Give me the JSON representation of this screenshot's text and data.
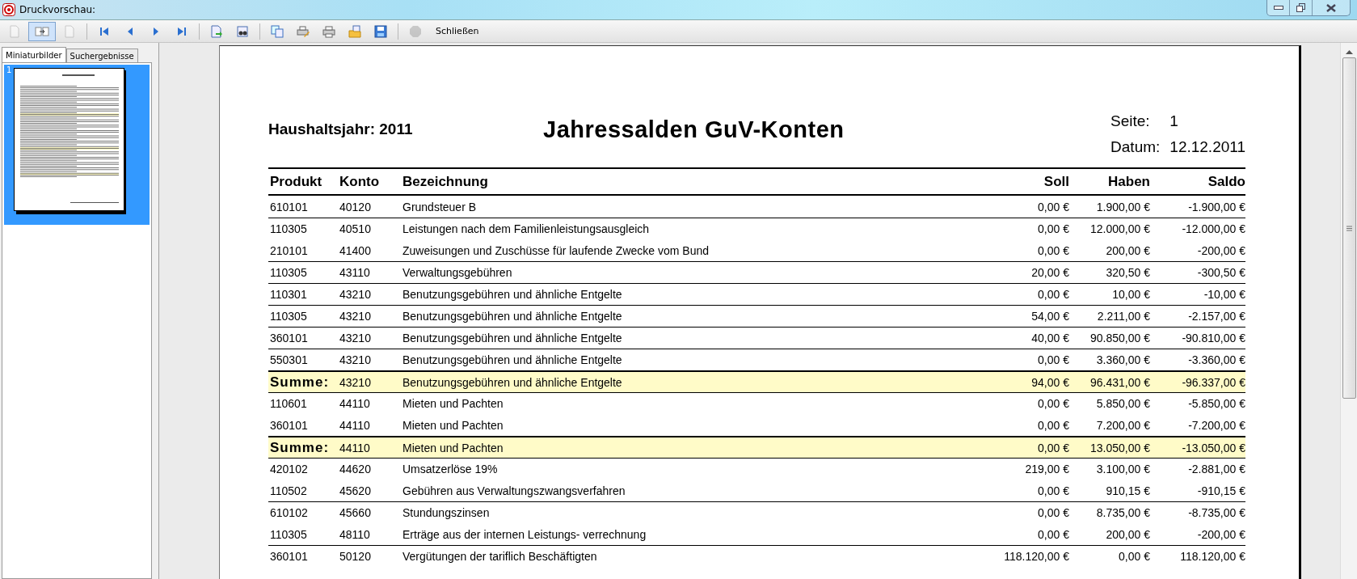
{
  "window": {
    "title": "Druckvorschau:"
  },
  "toolbar": {
    "buttons": [
      {
        "disabled": true,
        "selected": false
      },
      {
        "disabled": false,
        "selected": true
      },
      {
        "disabled": true,
        "selected": false
      },
      {
        "disabled": false,
        "selected": false
      },
      {
        "disabled": false,
        "selected": false
      },
      {
        "disabled": false,
        "selected": false
      },
      {
        "disabled": false,
        "selected": false
      },
      {
        "disabled": false,
        "selected": false
      },
      {
        "disabled": false,
        "selected": false
      },
      {
        "disabled": false,
        "selected": false
      },
      {
        "disabled": false,
        "selected": false
      },
      {
        "disabled": false,
        "selected": false
      },
      {
        "disabled": false,
        "selected": false
      },
      {
        "disabled": false,
        "selected": false
      },
      {
        "disabled": true,
        "selected": false
      }
    ],
    "close_label": "Schließen"
  },
  "sidebar": {
    "tabs": [
      {
        "label": "Miniaturbilder",
        "selected": true
      },
      {
        "label": "Suchergebnisse",
        "selected": false
      }
    ],
    "thumbnails": [
      {
        "number": "1",
        "selected": true
      }
    ]
  },
  "report": {
    "year_label": "Haushaltsjahr: 2011",
    "title": "Jahressalden GuV-Konten",
    "page_label": "Seite:",
    "page_value": "1",
    "date_label": "Datum:",
    "date_value": "12.12.2011",
    "columns": [
      "Produkt",
      "Konto",
      "Bezeichnung",
      "Soll",
      "Haben",
      "Saldo"
    ],
    "rows": [
      {
        "kind": "item",
        "rule_above": false,
        "cells": [
          "610101",
          "40120",
          "Grundsteuer B",
          "0,00 €",
          "1.900,00 €",
          "-1.900,00 €"
        ]
      },
      {
        "kind": "item",
        "rule_above": true,
        "cells": [
          "110305",
          "40510",
          "Leistungen nach dem Familienleistungsausgleich",
          "0,00 €",
          "12.000,00 €",
          "-12.000,00 €"
        ]
      },
      {
        "kind": "item",
        "rule_above": false,
        "cells": [
          "210101",
          "41400",
          "Zuweisungen und Zuschüsse für laufende Zwecke vom Bund",
          "0,00 €",
          "200,00 €",
          "-200,00 €"
        ]
      },
      {
        "kind": "item",
        "rule_above": true,
        "cells": [
          "110305",
          "43110",
          "Verwaltungsgebühren",
          "20,00 €",
          "320,50 €",
          "-300,50 €"
        ]
      },
      {
        "kind": "item",
        "rule_above": true,
        "cells": [
          "110301",
          "43210",
          "Benutzungsgebühren und ähnliche Entgelte",
          "0,00 €",
          "10,00 €",
          "-10,00 €"
        ]
      },
      {
        "kind": "item",
        "rule_above": true,
        "cells": [
          "110305",
          "43210",
          "Benutzungsgebühren und ähnliche Entgelte",
          "54,00 €",
          "2.211,00 €",
          "-2.157,00 €"
        ]
      },
      {
        "kind": "item",
        "rule_above": true,
        "cells": [
          "360101",
          "43210",
          "Benutzungsgebühren und ähnliche Entgelte",
          "40,00 €",
          "90.850,00 €",
          "-90.810,00 €"
        ]
      },
      {
        "kind": "item",
        "rule_above": true,
        "cells": [
          "550301",
          "43210",
          "Benutzungsgebühren und ähnliche Entgelte",
          "0,00 €",
          "3.360,00 €",
          "-3.360,00 €"
        ]
      },
      {
        "kind": "sum",
        "rule_above": true,
        "cells": [
          "Summe:",
          "43210",
          "Benutzungsgebühren und ähnliche Entgelte",
          "94,00 €",
          "96.431,00 €",
          "-96.337,00 €"
        ]
      },
      {
        "kind": "item",
        "rule_above": true,
        "cells": [
          "110601",
          "44110",
          "Mieten und Pachten",
          "0,00 €",
          "5.850,00 €",
          "-5.850,00 €"
        ]
      },
      {
        "kind": "item",
        "rule_above": false,
        "cells": [
          "360101",
          "44110",
          "Mieten und Pachten",
          "0,00 €",
          "7.200,00 €",
          "-7.200,00 €"
        ]
      },
      {
        "kind": "sum",
        "rule_above": true,
        "cells": [
          "Summe:",
          "44110",
          "Mieten und Pachten",
          "0,00 €",
          "13.050,00 €",
          "-13.050,00 €"
        ]
      },
      {
        "kind": "item",
        "rule_above": true,
        "cells": [
          "420102",
          "44620",
          "Umsatzerlöse 19%",
          "219,00 €",
          "3.100,00 €",
          "-2.881,00 €"
        ]
      },
      {
        "kind": "item",
        "rule_above": false,
        "cells": [
          "110502",
          "45620",
          "Gebühren aus Verwaltungszwangsverfahren",
          "0,00 €",
          "910,15 €",
          "-910,15 €"
        ]
      },
      {
        "kind": "item",
        "rule_above": true,
        "cells": [
          "610102",
          "45660",
          "Stundungszinsen",
          "0,00 €",
          "8.735,00 €",
          "-8.735,00 €"
        ]
      },
      {
        "kind": "item",
        "rule_above": false,
        "cells": [
          "110305",
          "48110",
          "Erträge aus der internen Leistungs- verrechnung",
          "0,00 €",
          "200,00 €",
          "-200,00 €"
        ]
      },
      {
        "kind": "item",
        "rule_above": true,
        "cells": [
          "360101",
          "50120",
          "Vergütungen der tariflich Beschäftigten",
          "118.120,00 €",
          "0,00 €",
          "118.120,00 €"
        ]
      }
    ]
  }
}
